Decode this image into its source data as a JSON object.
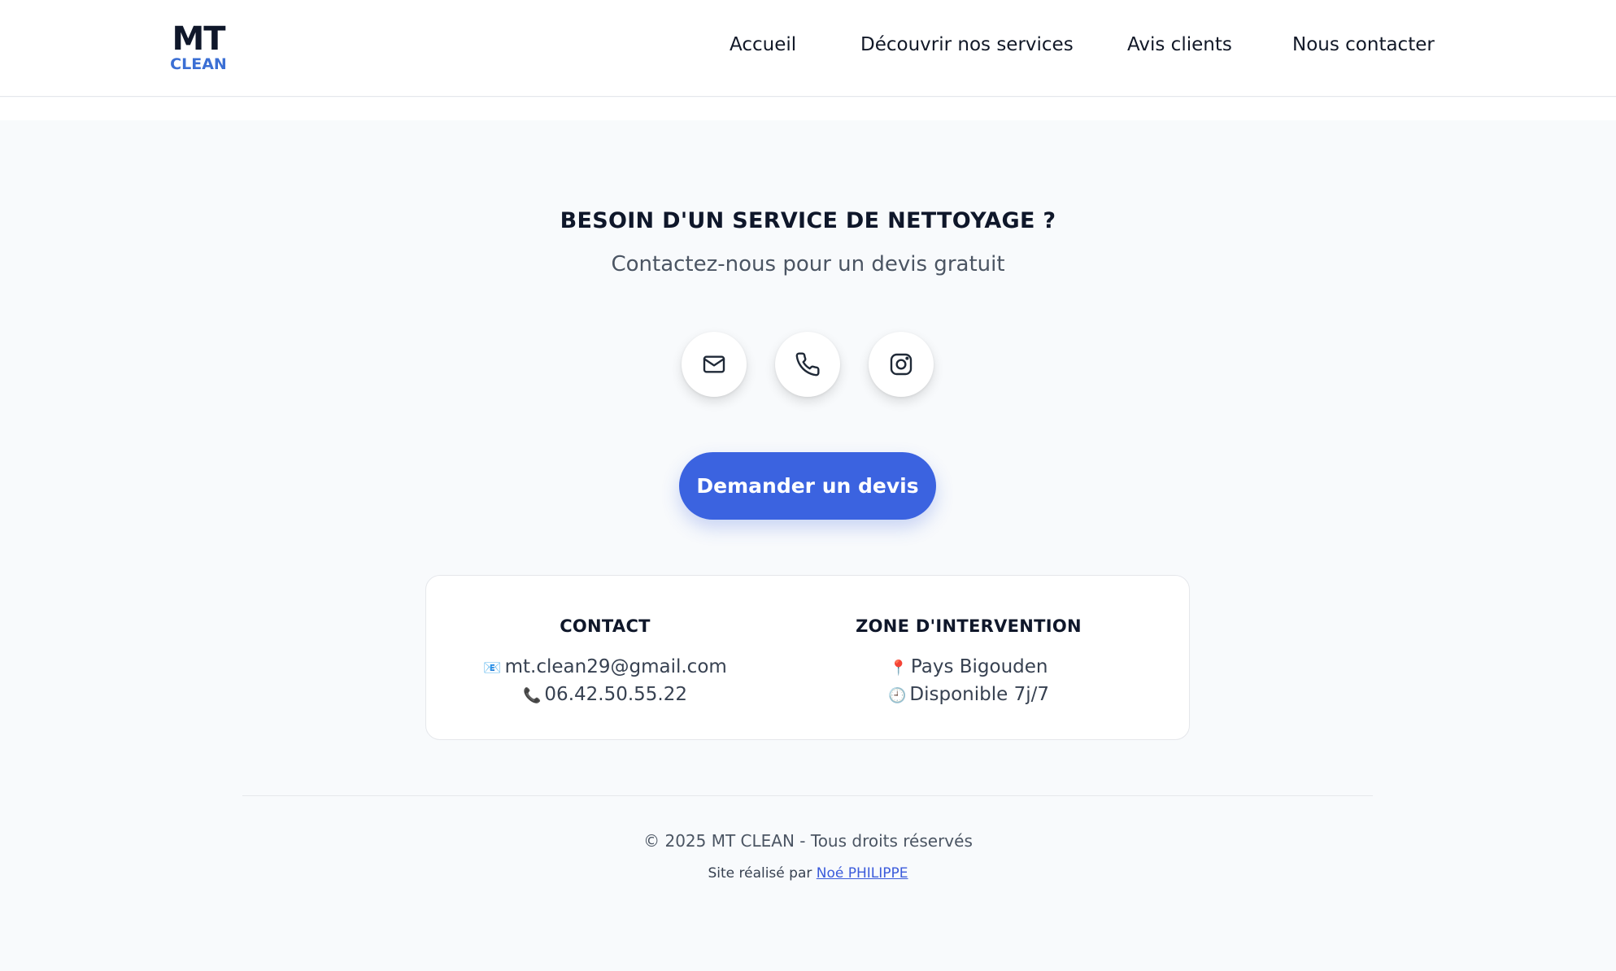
{
  "header": {
    "logo_top": "MT",
    "logo_bottom": "CLEAN",
    "nav": [
      "Accueil",
      "Découvrir nos services",
      "Avis clients",
      "Nous contacter"
    ]
  },
  "hero": {
    "title": "BESOIN D'UN SERVICE DE NETTOYAGE ?",
    "subtitle": "Contactez-nous pour un devis gratuit",
    "icons": [
      "mail-icon",
      "phone-icon",
      "instagram-icon"
    ],
    "cta_label": "Demander un devis"
  },
  "info": {
    "contact": {
      "heading": "CONTACT",
      "email_emoji": "📧",
      "email": "mt.clean29@gmail.com",
      "phone_emoji": "📞",
      "phone": "06.42.50.55.22"
    },
    "zone": {
      "heading": "ZONE D'INTERVENTION",
      "place_emoji": "📍",
      "place": "Pays Bigouden",
      "time_emoji": "🕘",
      "availability": "Disponible 7j/7"
    }
  },
  "footer": {
    "copyright": "© 2025 MT CLEAN - Tous droits réservés",
    "credit_prefix": "Site réalisé par",
    "credit_link": "Noé PHILIPPE"
  },
  "colors": {
    "brand_dark": "#0f172a",
    "brand_blue": "#3b6fd4",
    "cta": "#3b63e0",
    "background": "#f8fafc"
  }
}
